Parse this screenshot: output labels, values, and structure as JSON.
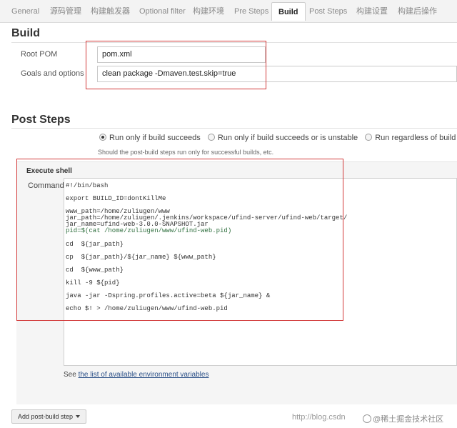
{
  "tabs": [
    {
      "label": "General",
      "active": false
    },
    {
      "label": "源码管理",
      "active": false
    },
    {
      "label": "构建触发器",
      "active": false
    },
    {
      "label": "Optional filter",
      "active": false
    },
    {
      "label": "构建环境",
      "active": false
    },
    {
      "label": "Pre Steps",
      "active": false
    },
    {
      "label": "Build",
      "active": true
    },
    {
      "label": "Post Steps",
      "active": false
    },
    {
      "label": "构建设置",
      "active": false
    },
    {
      "label": "构建后操作",
      "active": false
    }
  ],
  "build": {
    "title": "Build",
    "root_pom_label": "Root POM",
    "root_pom_value": "pom.xml",
    "goals_label": "Goals and options",
    "goals_value": "clean package -Dmaven.test.skip=true"
  },
  "post_steps": {
    "title": "Post Steps",
    "options": [
      {
        "label": "Run only if build succeeds",
        "checked": true
      },
      {
        "label": "Run only if build succeeds or is unstable",
        "checked": false
      },
      {
        "label": "Run regardless of build result",
        "checked": false
      }
    ],
    "hint": "Should the post-build steps run only for successful builds, etc."
  },
  "execute_shell": {
    "title": "Execute shell",
    "command_label": "Command",
    "lines": [
      "#!/bin/bash",
      "export BUILD_ID=dontKillMe",
      "www_path=/home/zuliugen/www",
      "jar_path=/home/zuliugen/.jenkins/workspace/ufind-server/ufind-web/target/",
      "jar_name=ufind-web-3.0.0-SNAPSHOT.jar",
      "pid=$(cat /home/zuliugen/www/ufind-web.pid)",
      "cd  ${jar_path}",
      "cp  ${jar_path}/${jar_name} ${www_path}",
      "cd  ${www_path}",
      "kill -9 ${pid}",
      "java -jar -Dspring.profiles.active=beta ${jar_name} &",
      "echo $! > /home/zuliugen/www/ufind-web.pid"
    ]
  },
  "env_vars": {
    "prefix": "See ",
    "link": "the list of available environment variables"
  },
  "add_post_build_step": "Add post-build step",
  "watermark": {
    "url": "http://blog.csdn",
    "brand": "@稀土掘金技术社区"
  },
  "colors": {
    "annotation_red": "#d23a3a",
    "link_blue": "#2a4f87"
  }
}
